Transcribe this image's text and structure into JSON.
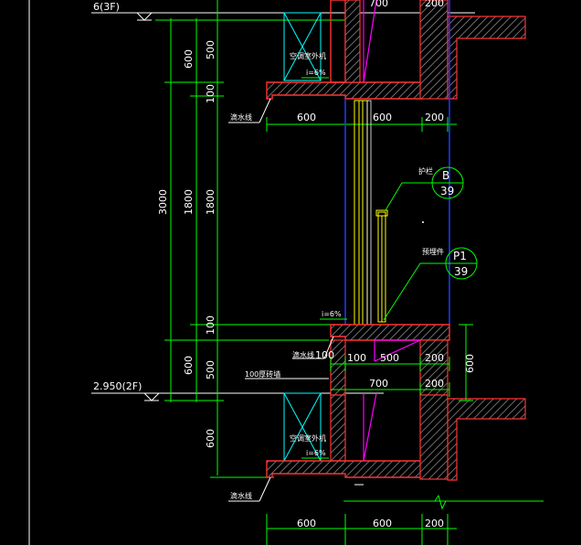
{
  "title": "",
  "levels": {
    "upper": "6(3F)",
    "lower": "2.950(2F)"
  },
  "left_dims": {
    "total": "3000",
    "col1": [
      "600",
      "1800",
      "600"
    ],
    "col2_top": [
      "500",
      "100"
    ],
    "col2_mid": "1800",
    "col2_bot": [
      "100",
      "500"
    ],
    "col3_bot": "600"
  },
  "bottom_dims": {
    "upper_row": [
      "600",
      "600",
      "200"
    ],
    "mid_row1": [
      "100",
      "500",
      "200"
    ],
    "mid_row2": [
      "700",
      "200"
    ],
    "top_row": [
      "700",
      "200"
    ],
    "final_row": [
      "600",
      "600",
      "200"
    ],
    "right_600": "600"
  },
  "labels": {
    "ac_unit": "空调室外机",
    "drip_line": "滴水线",
    "slope": "i=6%",
    "railing": "护栏",
    "embedded": "预埋件",
    "wall100": "100厚砖墙",
    "drip_line_mid": "滴水线"
  },
  "callouts": [
    {
      "top": "B",
      "bottom": "39"
    },
    {
      "top": "P1",
      "bottom": "39"
    }
  ],
  "colors": {
    "dim_line": "#00ff00",
    "wall": "#ff3333",
    "hatch": "#ffffff",
    "blue": "#1e3cff",
    "yellow": "#ffff00",
    "magenta": "#ff00ff",
    "cyan": "#00ffff"
  }
}
